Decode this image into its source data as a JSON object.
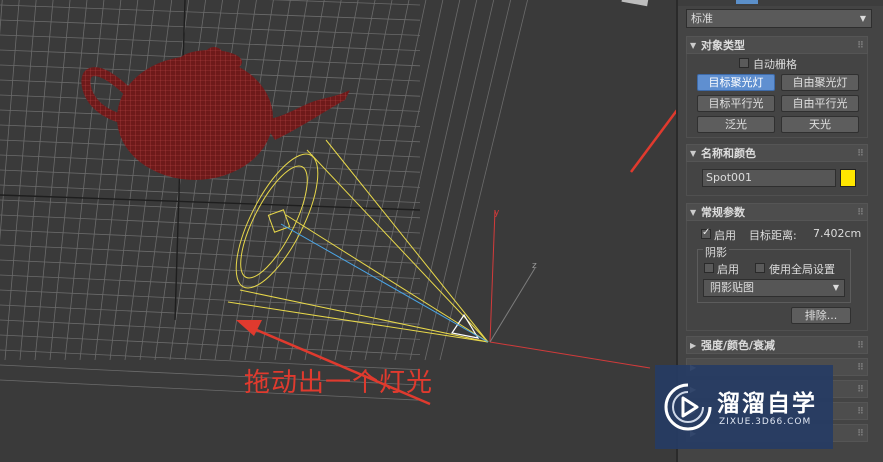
{
  "annotation": {
    "text": "拖动出一个灯光"
  },
  "panel": {
    "dropdown_value": "标准",
    "object_type": {
      "title": "对象类型",
      "autogrid_label": "自动栅格",
      "buttons": [
        "目标聚光灯",
        "自由聚光灯",
        "目标平行光",
        "自由平行光",
        "泛光",
        "天光"
      ]
    },
    "name_color": {
      "title": "名称和颜色",
      "name_value": "Spot001",
      "color": "#ffe600"
    },
    "general_params": {
      "title": "常规参数",
      "enable_label": "启用",
      "target_distance_label": "目标距离:",
      "target_distance_value": "7.402cm",
      "shadows_label": "阴影",
      "shadow_enable_label": "启用",
      "global_settings_label": "使用全局设置",
      "shadow_type": "阴影贴图",
      "exclude_button": "排除..."
    },
    "intensity": {
      "title": "强度/颜色/衰减"
    }
  },
  "logo": {
    "name": "溜溜自学",
    "url": "ZIXUE.3D66.COM"
  },
  "colors": {
    "accent_active": "#5f8fd0",
    "annotation": "#e03a2e",
    "light_wire": "#e8d84a",
    "teapot": "#7a1f1f"
  }
}
